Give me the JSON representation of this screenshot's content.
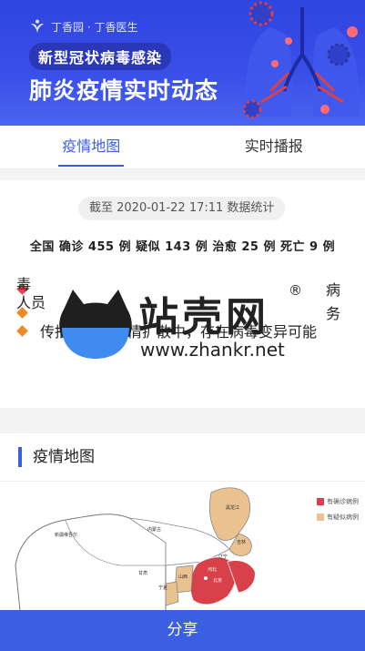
{
  "banner": {
    "brand": "丁香园 · 丁香医生",
    "pill_title": "新型冠状病毒感染",
    "title": "肺炎疫情实时动态"
  },
  "tabs": [
    {
      "label": "疫情地图",
      "active": true
    },
    {
      "label": "实时播报",
      "active": false
    }
  ],
  "stats": {
    "date_text": "截至 2020-01-22 17:11 数据统计",
    "summary": "全国 确诊 455 例 疑似 143 例 治愈 25 例 死亡 9 例",
    "bullets": [
      {
        "text": "病",
        "prefix": "",
        "color": "#e8464a"
      },
      {
        "text": "毒",
        "prefix": "",
        "color": "#e8464a"
      },
      {
        "text": "务",
        "prefix": "",
        "color": "#f08a24"
      },
      {
        "text": "人员",
        "prefix": "",
        "color": "#f08a24"
      },
      {
        "text": "传播进展：疫情扩散中，存在病毒变异可能",
        "prefix": "",
        "color": "#f08a24"
      }
    ]
  },
  "watermark": {
    "title": "站壳网",
    "reg": "®",
    "url": "www.zhankr.net"
  },
  "map_section": {
    "title": "疫情地图",
    "legend": [
      {
        "label": "有确诊病例",
        "color": "#d9414a"
      },
      {
        "label": "有疑似病例",
        "color": "#e9c28f"
      }
    ],
    "region_labels": [
      "新疆维吾尔",
      "内蒙古",
      "黑龙江",
      "吉林",
      "辽宁",
      "甘肃",
      "宁夏",
      "山西",
      "河北",
      "北京"
    ]
  },
  "share": {
    "label": "分享"
  },
  "colors": {
    "accent": "#3b5fe0",
    "banner": "#3a4fe8",
    "confirmed": "#d9414a",
    "suspected": "#e9c28f"
  }
}
